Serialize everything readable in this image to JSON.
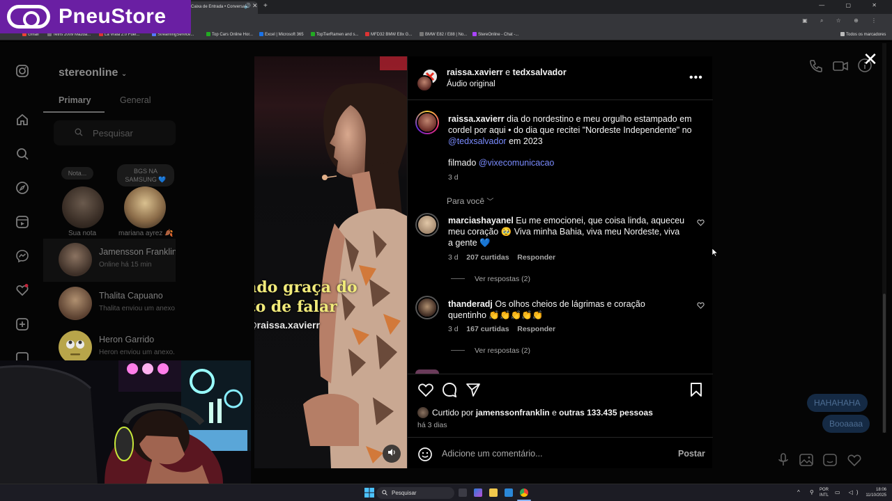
{
  "browser": {
    "active_tab_title": "Caixa de Entrada • Conversas",
    "bookmarks": [
      "Gmail",
      "Tetris 2009 Mazda...",
      "La Vraia 2.0 Fuel...",
      "StreamingService...",
      "Top Cars Online Hor...",
      "Excel | Microsoft 365",
      "TopTierRamen and s...",
      "MFD32 BMW E8x G...",
      "BMW E82 / E88 | No...",
      "StereOnline - Chat -..."
    ],
    "bookmarks_all": "Todos os marcadores"
  },
  "overlay_logo": "PneuStore",
  "sidebar": {
    "account": "stereonline",
    "tabs": {
      "primary": "Primary",
      "general": "General"
    },
    "search_placeholder": "Pesquisar",
    "notes": [
      {
        "bubble": "Nota...",
        "label": "Sua nota"
      },
      {
        "bubble": "BGS NA SAMSUNG 💙",
        "label": "mariana ayrez 🍂"
      }
    ],
    "threads": [
      {
        "name": "Jamensson Franklin",
        "sub": "Online há 15 min"
      },
      {
        "name": "Thalita Capuano",
        "sub": "Thalita enviou um anexo."
      },
      {
        "name": "Heron Garrido",
        "sub": "Heron enviou um anexo."
      }
    ]
  },
  "chat_bubbles": [
    "HAHAHAHA",
    "Booaaaa"
  ],
  "video_caption": {
    "line1": "Fazendo graça do",
    "line2": "jeito de falar",
    "handle": "@raissa.xavierr"
  },
  "post": {
    "header_users": "raissa.xavierr",
    "header_and": "e",
    "header_user2": "tedxsalvador",
    "audio": "Áudio original",
    "caption": {
      "user": "raissa.xavierr",
      "text": "dia do nordestino e meu orgulho estampado em cordel por aqui • do dia que recitei \"Nordeste Independente\" no",
      "mention": "@tedxsalvador",
      "text2": "em 2023",
      "filmed": "filmado",
      "filmed_mention": "@vixecomunicacao",
      "time": "3 d"
    },
    "for_you": "Para você",
    "comments": [
      {
        "user": "marciashayanel",
        "text": "Eu me emocionei, que coisa linda, aqueceu meu coração 🥹 Viva minha Bahia, viva meu Nordeste, viva a gente 💙",
        "time": "3 d",
        "likes": "207 curtidas",
        "reply": "Responder",
        "replies": "Ver respostas (2)"
      },
      {
        "user": "thanderadj",
        "text": "Os olhos cheios de lágrimas e coração quentinho 👏👏👏👏👏",
        "time": "3 d",
        "likes": "167 curtidas",
        "reply": "Responder",
        "replies": "Ver respostas (2)"
      }
    ],
    "liked_by_prefix": "Curtido por",
    "liked_by_user": "jamenssonfranklin",
    "liked_by_and": "e",
    "liked_by_others": "outras 133.435 pessoas",
    "posted_ago": "há 3 dias",
    "comment_placeholder": "Adicione um comentário...",
    "post_button": "Postar"
  },
  "taskbar": {
    "search": "Pesquisar",
    "lang1": "POR",
    "lang2": "INTL",
    "time": "18:06",
    "date": "11/10/2025"
  }
}
